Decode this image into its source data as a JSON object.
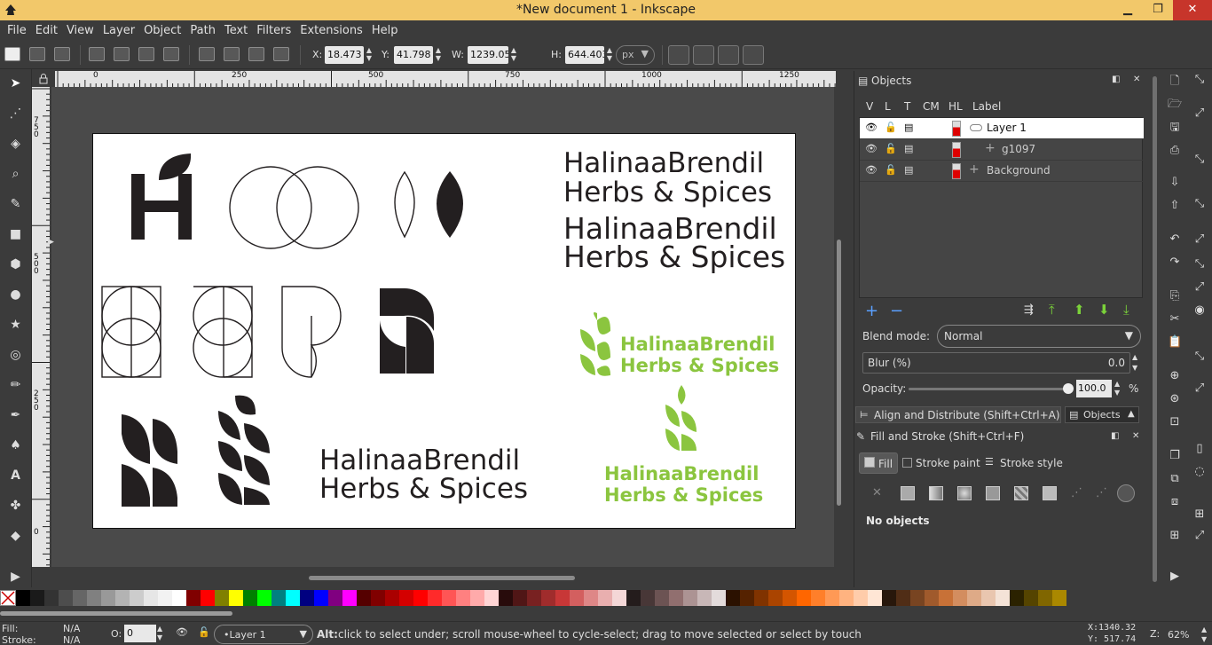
{
  "window": {
    "title": "*New document 1 - Inkscape",
    "minimize": "▁",
    "maximize": "❐",
    "close": "✕"
  },
  "menu": [
    "File",
    "Edit",
    "View",
    "Layer",
    "Object",
    "Path",
    "Text",
    "Filters",
    "Extensions",
    "Help"
  ],
  "toolbar": {
    "x_label": "X:",
    "x_value": "18.473",
    "y_label": "Y:",
    "y_value": "41.798",
    "w_label": "W:",
    "w_value": "1239.05",
    "h_label": "H:",
    "h_value": "644.403",
    "unit": "px",
    "spin_up": "▲",
    "spin_down": "▼"
  },
  "ruler": {
    "h_ticks": [
      "0",
      "250",
      "500",
      "750",
      "1000",
      "1250"
    ],
    "v_ticks": [
      "750",
      "500",
      "250",
      "0"
    ]
  },
  "canvas": {
    "texts": {
      "t1a": "HalinaaBrendil",
      "t1b": "Herbs & Spices",
      "t2a": "HalinaaBrendil",
      "t2b": "Herbs & Spices",
      "t3a": "HalinaaBrendil",
      "t3b": "Herbs & Spices",
      "t4a": "HalinaaBrendil",
      "t4b": "Herbs & Spices",
      "t5a": "HalinaaBrendil",
      "t5b": "Herbs & Spices"
    },
    "colors": {
      "dark": "#231f20",
      "green": "#8bc53f",
      "paper": "#ffffff"
    }
  },
  "objects_panel": {
    "title": "Objects",
    "columns": [
      "V",
      "L",
      "T",
      "CM",
      "HL",
      "Label"
    ],
    "rows": [
      {
        "label": "Layer 1",
        "selected": true
      },
      {
        "label": "g1097",
        "selected": false
      },
      {
        "label": "Background",
        "selected": false
      }
    ],
    "blend_label": "Blend mode:",
    "blend_value": "Normal",
    "blur_label": "Blur (%)",
    "blur_value": "0.0",
    "opacity_label": "Opacity:",
    "opacity_value": "100.0",
    "opacity_unit": "%"
  },
  "docked_tabs": {
    "align": "Align and Distribute (Shift+Ctrl+A)",
    "objects": "Objects"
  },
  "fill_stroke": {
    "title": "Fill and Stroke (Shift+Ctrl+F)",
    "tabs": [
      "Fill",
      "Stroke paint",
      "Stroke style"
    ],
    "message": "No objects"
  },
  "palette": [
    "#000000",
    "#1a1a1a",
    "#333333",
    "#4d4d4d",
    "#666666",
    "#808080",
    "#999999",
    "#b3b3b3",
    "#cccccc",
    "#e6e6e6",
    "#f2f2f2",
    "#ffffff",
    "#800000",
    "#ff0000",
    "#808000",
    "#ffff00",
    "#008000",
    "#00ff00",
    "#008080",
    "#00ffff",
    "#000080",
    "#0000ff",
    "#800080",
    "#ff00ff",
    "#550000",
    "#800000",
    "#aa0000",
    "#d40000",
    "#ff0000",
    "#ff2a2a",
    "#ff5555",
    "#ff8080",
    "#ffaaaa",
    "#ffd5d5",
    "#280b0b",
    "#501616",
    "#782121",
    "#a02c2c",
    "#c83737",
    "#d35f5f",
    "#de8787",
    "#e9afaf",
    "#f4d7d7",
    "#241c1c",
    "#483737",
    "#6c5353",
    "#916f6f",
    "#ac9393",
    "#c8b7b7",
    "#e3dbdb",
    "#2b1100",
    "#552200",
    "#803300",
    "#aa4400",
    "#d45500",
    "#ff6600",
    "#ff7f2a",
    "#ff9955",
    "#ffb380",
    "#ffccaa",
    "#ffe6d5",
    "#28170b",
    "#502d16",
    "#784421",
    "#a05a2c",
    "#c87137",
    "#d38d5f",
    "#deaa87",
    "#e9c6af",
    "#f4e3d7",
    "#2b2200",
    "#554400",
    "#806600",
    "#aa8800"
  ],
  "status": {
    "fill_label": "Fill:",
    "fill_value": "N/A",
    "stroke_label": "Stroke:",
    "stroke_value": "N/A",
    "o_label": "O:",
    "o_value": "0",
    "layer": "•Layer 1",
    "message_key": "Alt:",
    "message": " click to select under; scroll mouse-wheel to cycle-select; drag to move selected or select by touch",
    "cursor_x": "X:1340.32",
    "cursor_y": "Y: 517.74",
    "zoom_label": "Z:",
    "zoom_value": "62%"
  }
}
